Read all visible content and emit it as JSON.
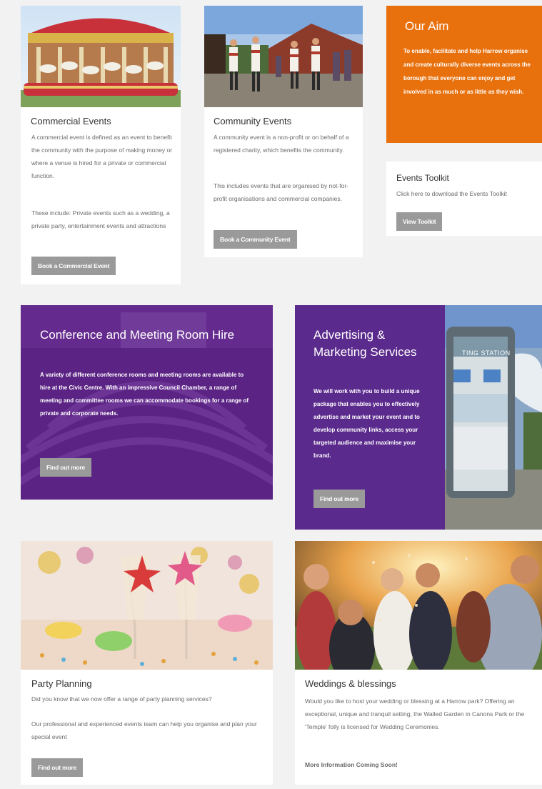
{
  "commercial": {
    "title": "Commercial Events",
    "para1": "A commercial event is defined as an event to benefit the community with the purpose of making money or where a venue is hired for a private or commercial function.",
    "para2": "These include: Private events such as a wedding, a private party, entertainment events and attractions",
    "button": "Book a Commercial Event"
  },
  "community": {
    "title": "Community Events",
    "para1": "A community event is a non-profit or on behalf of a registered charity, which benefits the community.",
    "para2": "This includes events that are organised by not-for-profit organisations and commercial companies.",
    "button": "Book a Community Event"
  },
  "aim": {
    "title": "Our Aim",
    "text": "To enable, facilitate and help Harrow organise and create culturally diverse events across the borough that everyone can enjoy and get involved in as much or as little as they wish."
  },
  "toolkit": {
    "title": "Events Toolkit",
    "text": "Click here to download the Events Toolkit",
    "button": "View Toolkit"
  },
  "conference": {
    "title": "Conference and Meeting Room Hire",
    "text": "A variety of different conference rooms and meeting rooms are available to hire at the Civic Centre. With an impressive Council Chamber, a range of meeting and committee rooms we can accommodate bookings for a range of private and corporate needs.",
    "button": "Find out more"
  },
  "advertising": {
    "title": "Advertising & Marketing Services",
    "text": "We will work with you to build a unique package that enables you to effectively advertise and market your event and to develop community links, access your targeted audience and maximise your brand.",
    "button": "Find out more",
    "sign_text": "TING STATION"
  },
  "party": {
    "title": "Party Planning",
    "para1": "Did you know that we now offer a range of party planning services?",
    "para2": "Our professional and experienced events team can help you organise and plan your special event",
    "button": "Find out more"
  },
  "weddings": {
    "title": "Weddings & blessings",
    "text": "Would you like to host your wedding or blessing at a Harrow park? Offering an exceptional, unique and tranquil setting, the Walled Garden in Canons Park or the 'Temple' folly is licensed for Wedding Ceremonies.",
    "coming": "More Information Coming Soon!"
  },
  "colors": {
    "accent_orange": "#e8710e",
    "promo_purple": "#6a2a8e",
    "button_grey": "#9a9a9a"
  }
}
